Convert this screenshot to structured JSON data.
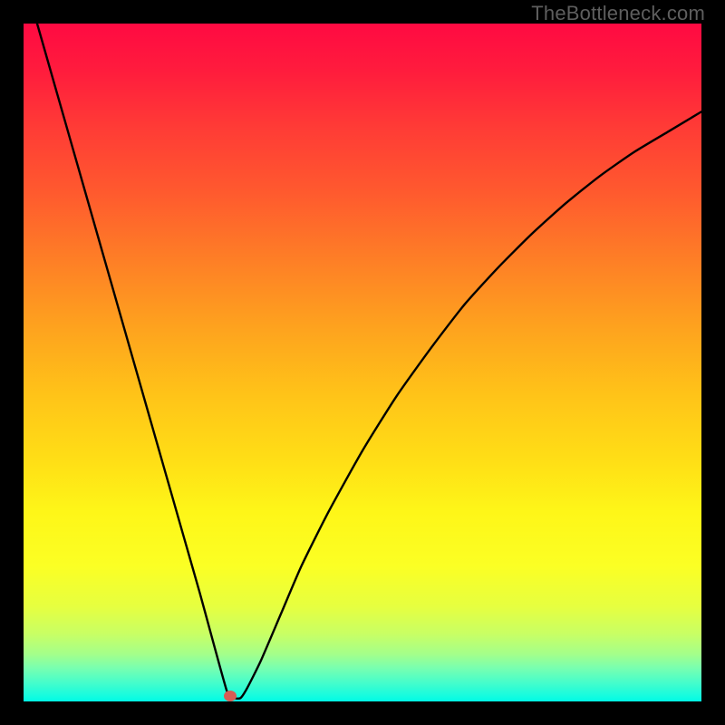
{
  "watermark": "TheBottleneck.com",
  "chart_data": {
    "type": "line",
    "title": "",
    "xlabel": "",
    "ylabel": "",
    "xlim": [
      0,
      100
    ],
    "ylim": [
      0,
      100
    ],
    "grid": false,
    "marker": {
      "x": 30.5,
      "y": 0.8
    },
    "series": [
      {
        "name": "curve",
        "x": [
          2,
          4,
          6,
          8,
          10,
          12,
          14,
          16,
          18,
          20,
          22,
          24,
          26,
          27.5,
          29,
          30,
          30.5,
          31,
          32,
          33,
          35,
          38,
          41,
          45,
          50,
          55,
          60,
          65,
          70,
          75,
          80,
          85,
          90,
          95,
          100
        ],
        "y": [
          100,
          93,
          86,
          79,
          72,
          65,
          58,
          51,
          44,
          37,
          30,
          23,
          16,
          10.5,
          5,
          1.5,
          0.8,
          0.5,
          0.5,
          2,
          6,
          13,
          20,
          28,
          37,
          45,
          52,
          58.5,
          64,
          69,
          73.5,
          77.5,
          81,
          84,
          87
        ]
      }
    ],
    "gradient_colors": {
      "top": "#ff0a42",
      "mid1": "#fe7f26",
      "mid2": "#ffe016",
      "mid3": "#fbff24",
      "bottom": "#00fbe6"
    }
  }
}
